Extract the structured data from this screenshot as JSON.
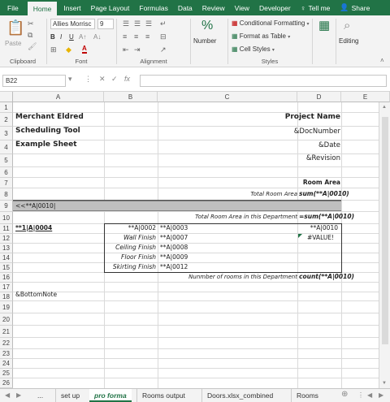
{
  "ribbon_tabs": [
    "File",
    "Home",
    "Insert",
    "Page Layout",
    "Formulas",
    "Data",
    "Review",
    "View",
    "Developer"
  ],
  "tell_me": "Tell me",
  "share": "Share",
  "clipboard": {
    "paste_label": "Paste",
    "group_label": "Clipboard"
  },
  "font": {
    "name": "Allies Morrisc",
    "size": "9",
    "group_label": "Font"
  },
  "alignment": {
    "group_label": "Alignment"
  },
  "number": {
    "label": "Number"
  },
  "styles": {
    "conditional": "Conditional Formatting",
    "format_table": "Format as Table",
    "cell_styles": "Cell Styles",
    "group_label": "Styles"
  },
  "cells": {
    "a2": "Merchant Eldred",
    "a3": "Scheduling Tool",
    "a4": "Example Sheet",
    "d2": "Project Name",
    "d3": "&DocNumber",
    "d4": "&Date",
    "d5": "&Revision",
    "d8": "Room Area",
    "c9": "Total Room Area",
    "d9": "sum(**A|0010)",
    "a10": "<<**A|0010|",
    "c11": "Total Room Area in this Department",
    "d11": "=sum(**A|0010)",
    "a12": "**1|A|0004",
    "b12": "**A|0002",
    "c12": "**A|0003",
    "d12": "**A|0010",
    "b13": "Wall Finish",
    "c13": "**A|0007",
    "d13": "#VALUE!",
    "b14": "Ceiling Finish",
    "c14": "**A|0008",
    "b15": "Floor Finish",
    "c15": "**A|0009",
    "b16": "Skirting Finish",
    "c16": "**A|0012",
    "c17": "Nunmber of rooms in this Department",
    "d17": "count(**A|0010)",
    "a19": "&BottomNote"
  },
  "editing": {
    "label": "Editing"
  },
  "formula_bar": {
    "name_box": "B22",
    "fx": "fx",
    "value": ""
  },
  "columns": [
    "A",
    "B",
    "C",
    "D",
    "E"
  ],
  "rows": [
    "1",
    "2",
    "3",
    "4",
    "5",
    "6",
    "7",
    "8",
    "9",
    "10",
    "11",
    "12",
    "13",
    "14",
    "15",
    "16",
    "17",
    "18",
    "19",
    "20",
    "21",
    "22",
    "23",
    "24",
    "25",
    "26"
  ],
  "sheet_tabs": [
    "...",
    "set up",
    "pro forma",
    "Rooms output",
    "Doors.xlsx_combined",
    "Rooms"
  ],
  "active_sheet": "pro forma",
  "colors": {
    "accent": "#217346",
    "band": "#bfbfbf"
  }
}
